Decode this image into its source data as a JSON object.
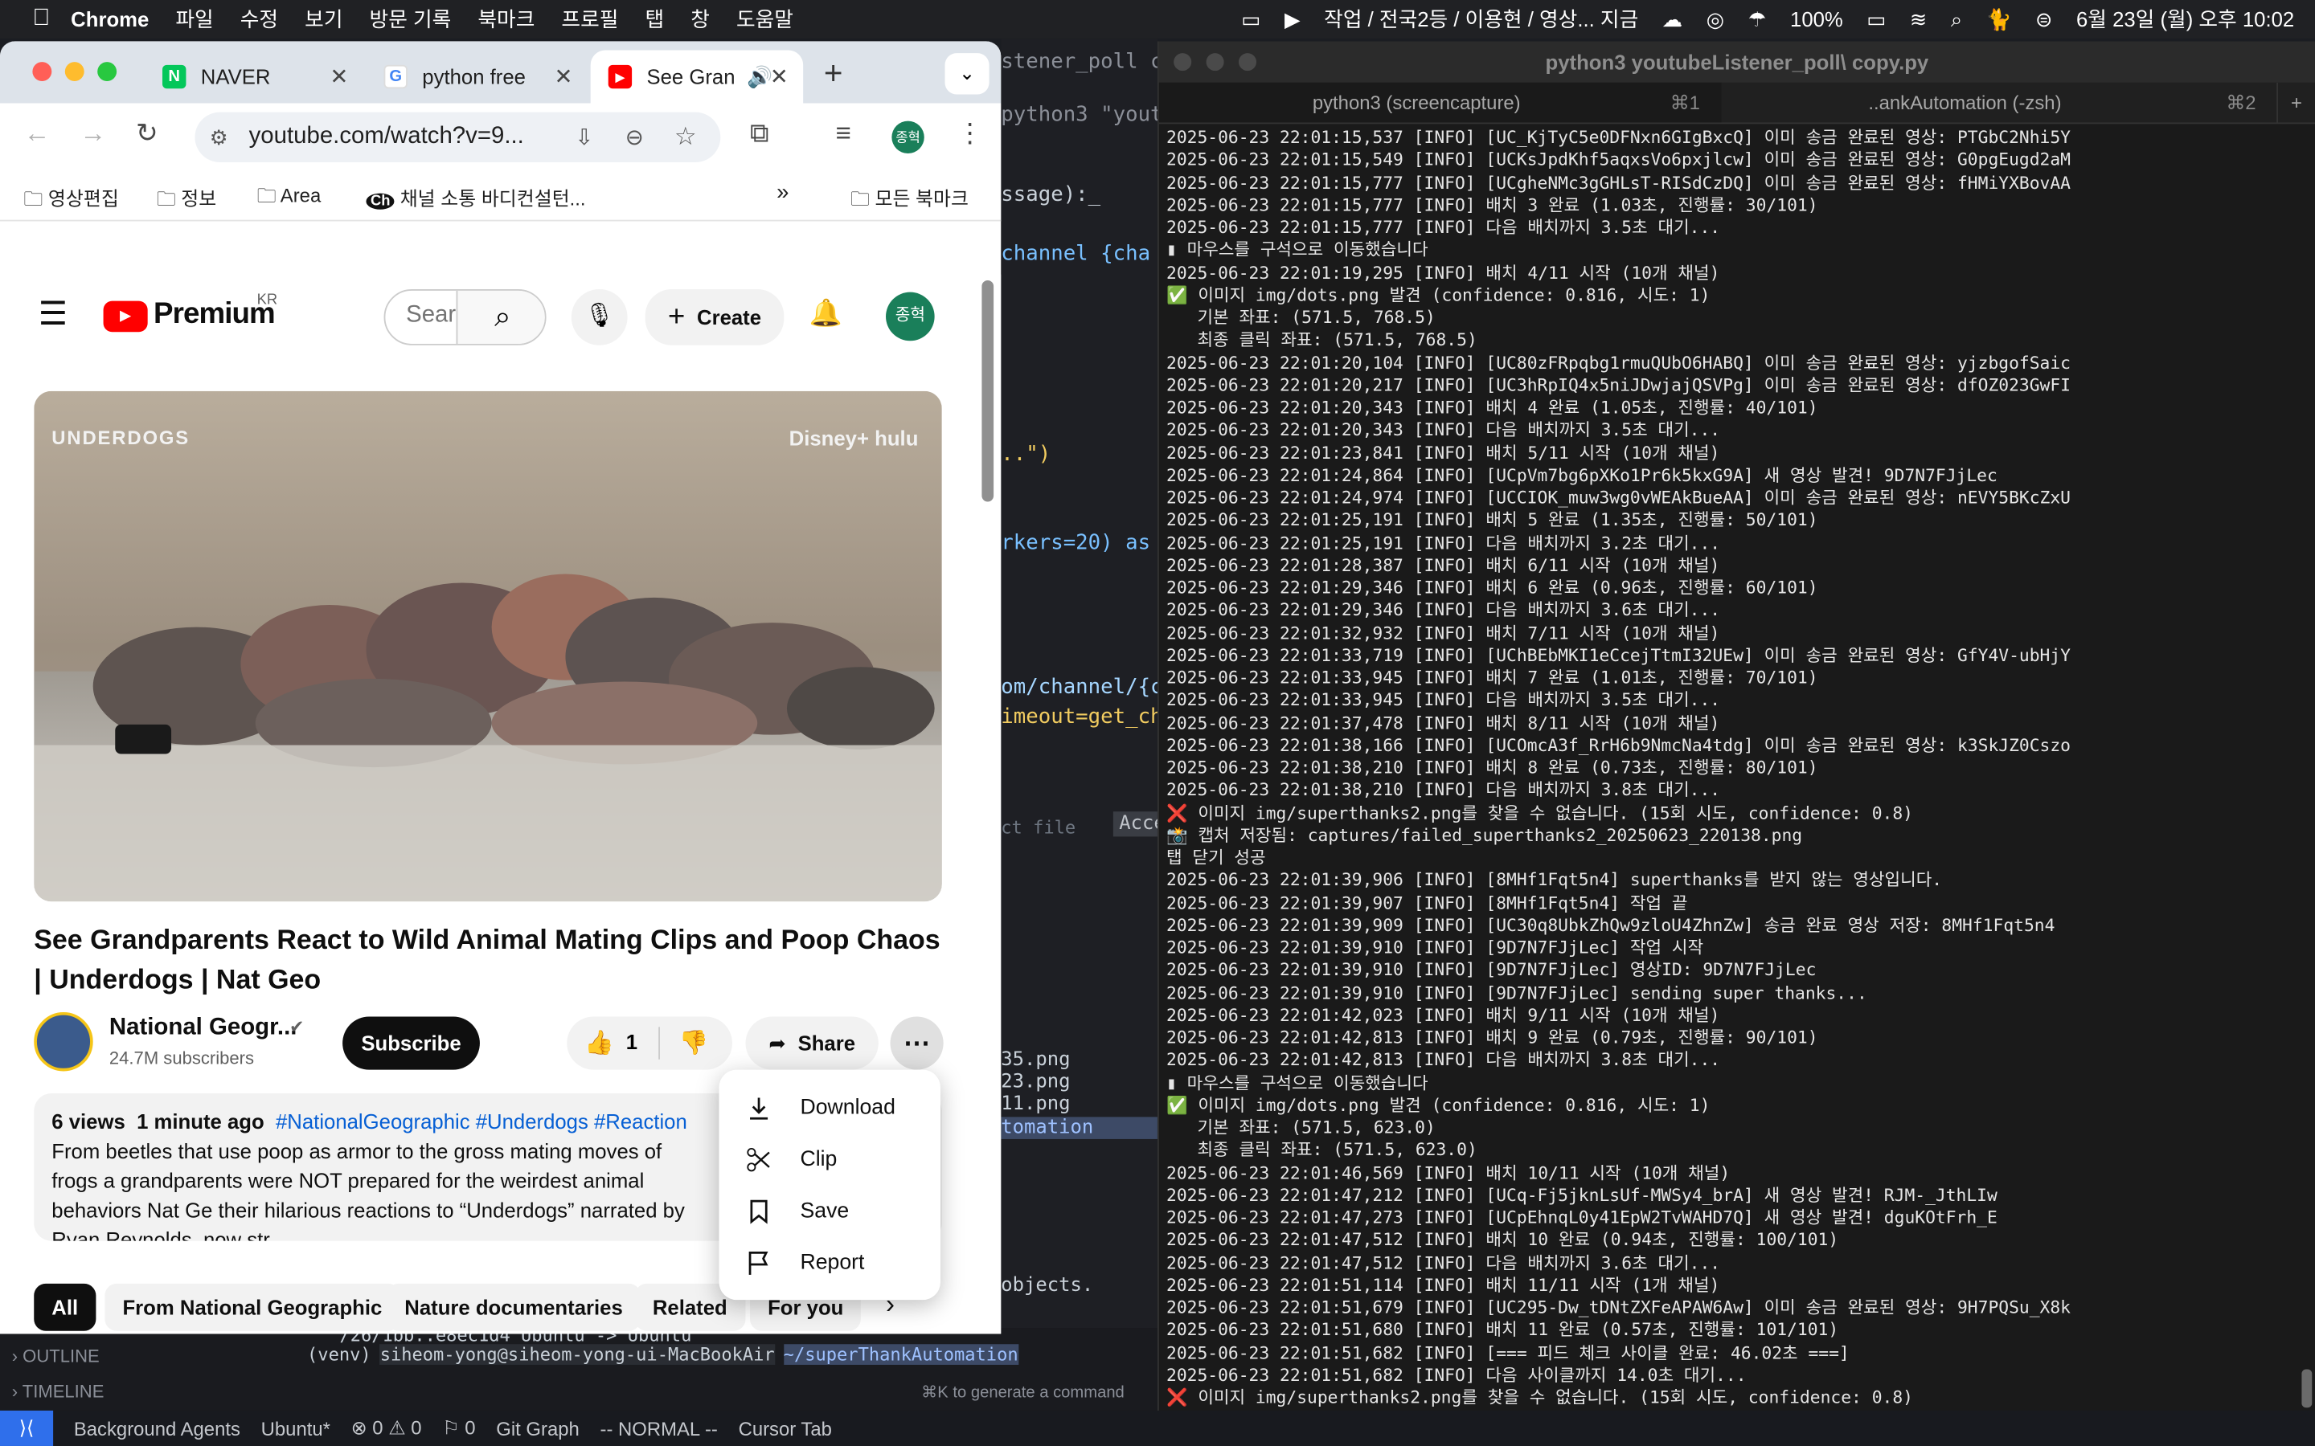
{
  "menubar": {
    "items": [
      "Chrome",
      "파일",
      "수정",
      "보기",
      "방문 기록",
      "북마크",
      "프로필",
      "탭",
      "창",
      "도움말"
    ],
    "now_playing": "작업 / 전국2등 / 이용현 / 영상... 지금",
    "battery": "100%",
    "datetime": "6월 23일 (월) 오후 10:02"
  },
  "browser": {
    "tabs": [
      {
        "label": "NAVER"
      },
      {
        "label": "python free"
      },
      {
        "label": "See Gran"
      }
    ],
    "url": "youtube.com/watch?v=9...",
    "profile": "종혁",
    "bookmarks": [
      "영상편집",
      "정보",
      "Area",
      "채널 소통 바디컨설턴...",
      "모든 북마크"
    ]
  },
  "youtube": {
    "logo": "Premium",
    "region": "KR",
    "search_placeholder": "Sear",
    "create": "Create",
    "avatar": "종혁",
    "video_overlay": {
      "left": "UNDERDOGS",
      "right": "Disney+ hulu"
    },
    "title": "See Grandparents React to Wild Animal Mating Clips and Poop Chaos | Underdogs | Nat Geo",
    "channel": "National Geogr...",
    "subscribers": "24.7M subscribers",
    "subscribe": "Subscribe",
    "likes": "1",
    "share": "Share",
    "views": "6 views",
    "time": "1 minute ago",
    "hashtags": "#NationalGeographic #Underdogs #Reaction",
    "description": "From beetles that use poop as armor to the gross mating moves of frogs a grandparents were NOT prepared for the weirdest animal behaviors Nat Ge their hilarious reactions to “Underdogs” narrated by Ryan Reynolds, now str",
    "menu": [
      "Download",
      "Clip",
      "Save",
      "Report"
    ],
    "chips": [
      "All",
      "From National Geographic",
      "Nature documentaries",
      "Related",
      "For you"
    ]
  },
  "editor": {
    "tab_path": "stener_poll copy.p",
    "lines": [
      "python3 \"youtube",
      "ssage):_",
      "channel {cha",
      "..\")",
      "rkers=20) as e",
      "om/channel/{ch",
      "imeout=get_cha",
      "ct file",
      "Acce",
      "35.png",
      "23.png",
      "11.png",
      "tomation",
      "objects."
    ],
    "outline": "OUTLINE",
    "timeline": "TIMELINE",
    "terminal_line1": "/26/1bb..e8ec1d4  Ubuntu -> Ubuntu",
    "prompt_env": "(venv)",
    "prompt_user": "siheom-yong@siheom-yong-ui-MacBookAir",
    "prompt_dir": "~/superThankAutomation",
    "hint": "⌘K to generate a command"
  },
  "statusbar": {
    "items": [
      "Background Agents",
      "Ubuntu*",
      "⊗ 0 ⚠ 0",
      "⚐ 0",
      "Git Graph",
      "-- NORMAL --",
      "Cursor Tab"
    ]
  },
  "terminal": {
    "title": "python3 youtubeListener_poll\\ copy.py",
    "tabs": [
      {
        "label": "python3 (screencapture)",
        "key": "⌘1"
      },
      {
        "label": "..ankAutomation (-zsh)",
        "key": "⌘2"
      }
    ],
    "lines": [
      "2025-06-23 22:01:15,537 [INFO] [UC_KjTyC5e0DFNxn6GIgBxcQ] 이미 송금 완료된 영상: PTGbC2Nhi5Y",
      "2025-06-23 22:01:15,549 [INFO] [UCKsJpdKhf5aqxsVo6pxjlcw] 이미 송금 완료된 영상: G0pgEugd2aM",
      "2025-06-23 22:01:15,777 [INFO] [UCgheNMc3gGHLsT-RISdCzDQ] 이미 송금 완료된 영상: fHMiYXBovAA",
      "2025-06-23 22:01:15,777 [INFO] 배치 3 완료 (1.03초, 진행률: 30/101)",
      "2025-06-23 22:01:15,777 [INFO] 다음 배치까지 3.5초 대기...",
      "▮ 마우스를 구석으로 이동했습니다",
      "2025-06-23 22:01:19,295 [INFO] 배치 4/11 시작 (10개 채널)",
      "✅ 이미지 img/dots.png 발견 (confidence: 0.816, 시도: 1)",
      "   기본 좌표: (571.5, 768.5)",
      "   최종 클릭 좌표: (571.5, 768.5)",
      "2025-06-23 22:01:20,104 [INFO] [UC80zFRpqbg1rmuQUbO6HABQ] 이미 송금 완료된 영상: yjzbgofSaic",
      "2025-06-23 22:01:20,217 [INFO] [UC3hRpIQ4x5niJDwjajQSVPg] 이미 송금 완료된 영상: dfOZ023GwFI",
      "2025-06-23 22:01:20,343 [INFO] 배치 4 완료 (1.05초, 진행률: 40/101)",
      "2025-06-23 22:01:20,343 [INFO] 다음 배치까지 3.5초 대기...",
      "2025-06-23 22:01:23,841 [INFO] 배치 5/11 시작 (10개 채널)",
      "2025-06-23 22:01:24,864 [INFO] [UCpVm7bg6pXKo1Pr6k5kxG9A] 새 영상 발견! 9D7N7FJjLec",
      "2025-06-23 22:01:24,974 [INFO] [UCCIOK_muw3wg0vWEAkBueAA] 이미 송금 완료된 영상: nEVY5BKcZxU",
      "2025-06-23 22:01:25,191 [INFO] 배치 5 완료 (1.35초, 진행률: 50/101)",
      "2025-06-23 22:01:25,191 [INFO] 다음 배치까지 3.2초 대기...",
      "2025-06-23 22:01:28,387 [INFO] 배치 6/11 시작 (10개 채널)",
      "2025-06-23 22:01:29,346 [INFO] 배치 6 완료 (0.96초, 진행률: 60/101)",
      "2025-06-23 22:01:29,346 [INFO] 다음 배치까지 3.6초 대기...",
      "2025-06-23 22:01:32,932 [INFO] 배치 7/11 시작 (10개 채널)",
      "2025-06-23 22:01:33,719 [INFO] [UChBEbMKI1eCcejTtmI32UEw] 이미 송금 완료된 영상: GfY4V-ubHjY",
      "2025-06-23 22:01:33,945 [INFO] 배치 7 완료 (1.01초, 진행률: 70/101)",
      "2025-06-23 22:01:33,945 [INFO] 다음 배치까지 3.5초 대기...",
      "2025-06-23 22:01:37,478 [INFO] 배치 8/11 시작 (10개 채널)",
      "2025-06-23 22:01:38,166 [INFO] [UCOmcA3f_RrH6b9NmcNa4tdg] 이미 송금 완료된 영상: k3SkJZ0Cszo",
      "2025-06-23 22:01:38,210 [INFO] 배치 8 완료 (0.73초, 진행률: 80/101)",
      "2025-06-23 22:01:38,210 [INFO] 다음 배치까지 3.8초 대기...",
      "❌ 이미지 img/superthanks2.png를 찾을 수 없습니다. (15회 시도, confidence: 0.8)",
      "📸 캡처 저장됨: captures/failed_superthanks2_20250623_220138.png",
      "탭 닫기 성공",
      "2025-06-23 22:01:39,906 [INFO] [8MHf1Fqt5n4] superthanks를 받지 않는 영상입니다.",
      "2025-06-23 22:01:39,907 [INFO] [8MHf1Fqt5n4] 작업 끝",
      "2025-06-23 22:01:39,909 [INFO] [UC30q8UbkZhQw9zloU4ZhnZw] 송금 완료 영상 저장: 8MHf1Fqt5n4",
      "2025-06-23 22:01:39,910 [INFO] [9D7N7FJjLec] 작업 시작",
      "2025-06-23 22:01:39,910 [INFO] [9D7N7FJjLec] 영상ID: 9D7N7FJjLec",
      "2025-06-23 22:01:39,910 [INFO] [9D7N7FJjLec] sending super thanks...",
      "2025-06-23 22:01:42,023 [INFO] 배치 9/11 시작 (10개 채널)",
      "2025-06-23 22:01:42,813 [INFO] 배치 9 완료 (0.79초, 진행률: 90/101)",
      "2025-06-23 22:01:42,813 [INFO] 다음 배치까지 3.8초 대기...",
      "▮ 마우스를 구석으로 이동했습니다",
      "✅ 이미지 img/dots.png 발견 (confidence: 0.816, 시도: 1)",
      "   기본 좌표: (571.5, 623.0)",
      "   최종 클릭 좌표: (571.5, 623.0)",
      "2025-06-23 22:01:46,569 [INFO] 배치 10/11 시작 (10개 채널)",
      "2025-06-23 22:01:47,212 [INFO] [UCq-Fj5jknLsUf-MWSy4_brA] 새 영상 발견! RJM-_JthLIw",
      "2025-06-23 22:01:47,273 [INFO] [UCpEhnqL0y41EpW2TvWAHD7Q] 새 영상 발견! dguKOtFrh_E",
      "2025-06-23 22:01:47,512 [INFO] 배치 10 완료 (0.94초, 진행률: 100/101)",
      "2025-06-23 22:01:47,512 [INFO] 다음 배치까지 3.6초 대기...",
      "2025-06-23 22:01:51,114 [INFO] 배치 11/11 시작 (1개 채널)",
      "2025-06-23 22:01:51,679 [INFO] [UC295-Dw_tDNtZXFeAPAW6Aw] 이미 송금 완료된 영상: 9H7PQSu_X8k",
      "2025-06-23 22:01:51,680 [INFO] 배치 11 완료 (0.57초, 진행률: 101/101)",
      "2025-06-23 22:01:51,682 [INFO] [=== 피드 체크 사이클 완료: 46.02초 ===]",
      "2025-06-23 22:01:51,682 [INFO] 다음 사이클까지 14.0초 대기...",
      "❌ 이미지 img/superthanks2.png를 찾을 수 없습니다. (15회 시도, confidence: 0.8)",
      "▯"
    ]
  },
  "colors": {
    "yt_red": "#ff0000",
    "accent_green": "#1a7f5a",
    "term_bg": "#1a1a1a"
  }
}
